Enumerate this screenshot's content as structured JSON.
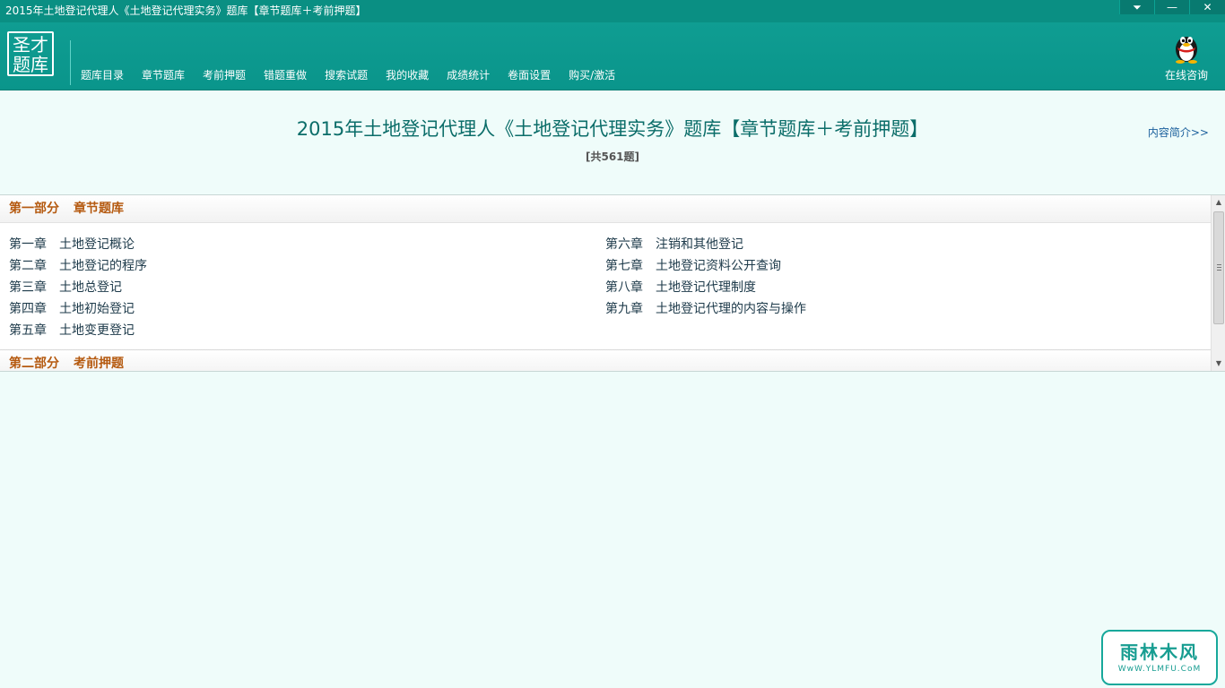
{
  "window": {
    "title": "2015年土地登记代理人《土地登记代理实务》题库【章节题库＋考前押题】",
    "controls": {
      "menu": "⏷",
      "minimize": "—",
      "close": "✕"
    }
  },
  "header": {
    "logo": {
      "line1": "圣才",
      "line2": "题库"
    },
    "nav": [
      "题库目录",
      "章节题库",
      "考前押题",
      "错题重做",
      "搜索试题",
      "我的收藏",
      "成绩统计",
      "卷面设置",
      "购买/激活"
    ],
    "consult": {
      "label": "在线咨询",
      "icon": "qq-penguin-icon"
    }
  },
  "main": {
    "title": "2015年土地登记代理人《土地登记代理实务》题库【章节题库＋考前押题】",
    "count": "[共561题]",
    "intro_link": "内容简介>>"
  },
  "parts": [
    {
      "label": "第一部分",
      "name": "章节题库",
      "chapters_left": [
        {
          "num": "第一章",
          "title": "土地登记概论"
        },
        {
          "num": "第二章",
          "title": "土地登记的程序"
        },
        {
          "num": "第三章",
          "title": "土地总登记"
        },
        {
          "num": "第四章",
          "title": "土地初始登记"
        },
        {
          "num": "第五章",
          "title": "土地变更登记"
        }
      ],
      "chapters_right": [
        {
          "num": "第六章",
          "title": "注销和其他登记"
        },
        {
          "num": "第七章",
          "title": "土地登记资料公开查询"
        },
        {
          "num": "第八章",
          "title": "土地登记代理制度"
        },
        {
          "num": "第九章",
          "title": "土地登记代理的内容与操作"
        }
      ]
    },
    {
      "label": "第二部分",
      "name": "考前押题"
    }
  ],
  "watermark": {
    "main": "雨林木风",
    "sub": "WwW.YLMFU.CoM"
  },
  "colors": {
    "header": "#0f9d92",
    "accent_text": "#b55a10",
    "title_text": "#0b6d69",
    "background": "#effcfa"
  }
}
